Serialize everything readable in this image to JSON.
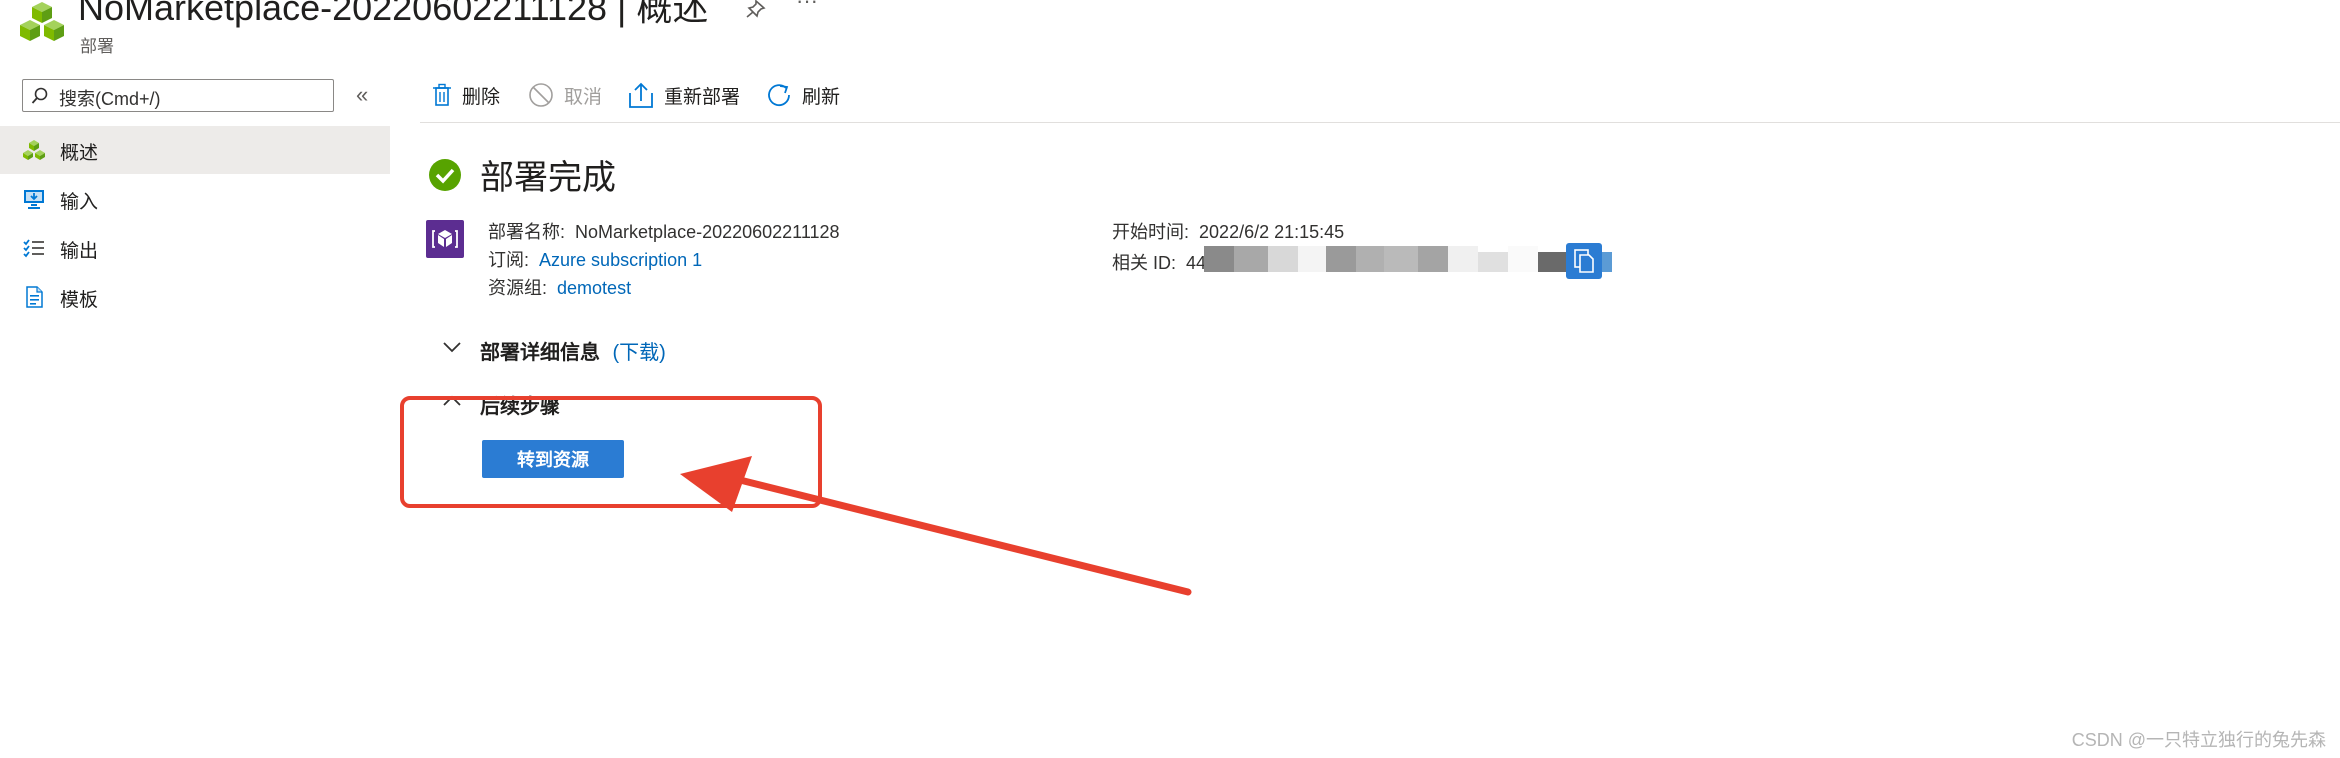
{
  "header": {
    "title": "NoMarketplace-20220602211128 | 概述",
    "subtitle": "部署",
    "pin_icon": "pin-icon",
    "more_icon": "ellipsis-icon",
    "more_label": "···"
  },
  "sidebar": {
    "search_placeholder": "搜索(Cmd+/)",
    "collapse_label": "«",
    "items": [
      {
        "label": "概述",
        "icon": "overview-icon",
        "active": true
      },
      {
        "label": "输入",
        "icon": "input-icon"
      },
      {
        "label": "输出",
        "icon": "output-icon"
      },
      {
        "label": "模板",
        "icon": "template-icon"
      }
    ]
  },
  "toolbar": {
    "delete": "删除",
    "cancel": "取消",
    "redeploy": "重新部署",
    "refresh": "刷新"
  },
  "main": {
    "status_title": "部署完成",
    "name_label": "部署名称:",
    "name_value": "NoMarketplace-20220602211128",
    "subscription_label": "订阅:",
    "subscription_value": "Azure subscription 1",
    "rg_label": "资源组:",
    "rg_value": "demotest",
    "start_label": "开始时间:",
    "start_value": "2022/6/2 21:15:45",
    "corr_label": "相关 ID:",
    "corr_value_prefix": "44",
    "details_label": "部署详细信息",
    "details_link": "(下载)",
    "next_label": "后续步骤",
    "goto_button": "转到资源"
  },
  "colors": {
    "accent": "#0067b8",
    "primary_button": "#2b7cd3",
    "success": "#57a300",
    "annotation": "#e8402e"
  },
  "watermark": "CSDN @一只特立独行的兔先森"
}
